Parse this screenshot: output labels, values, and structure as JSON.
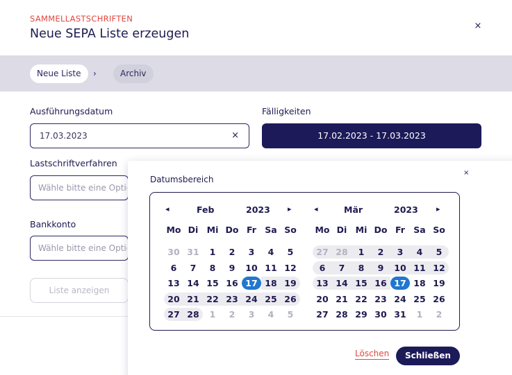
{
  "header": {
    "eyebrow": "SAMMELLASTSCHRIFTEN",
    "title": "Neue SEPA Liste erzeugen",
    "close": "×"
  },
  "breadcrumb": {
    "items": [
      "Neue Liste",
      "Archiv"
    ],
    "separator": "›"
  },
  "form": {
    "execution_date": {
      "label": "Ausführungsdatum",
      "value": "17.03.2023",
      "clear": "×"
    },
    "due_dates": {
      "label": "Fälligkeiten",
      "value": "17.02.2023 - 17.03.2023"
    },
    "method": {
      "label": "Lastschriftverfahren",
      "placeholder": "Wähle bitte eine Option"
    },
    "bank_account": {
      "label": "Bankkonto",
      "placeholder": "Wähle bitte eine Option"
    },
    "show_list_button": "Liste anzeigen"
  },
  "datepicker": {
    "title": "Datumsbereich",
    "close": "×",
    "prev_icon": "◂",
    "next_icon": "▸",
    "weekdays": [
      "Mo",
      "Di",
      "Mi",
      "Do",
      "Fr",
      "Sa",
      "So"
    ],
    "left": {
      "month": "Feb",
      "year": "2023",
      "weeks": [
        [
          "30",
          "31",
          "1",
          "2",
          "3",
          "4",
          "5"
        ],
        [
          "6",
          "7",
          "8",
          "9",
          "10",
          "11",
          "12"
        ],
        [
          "13",
          "14",
          "15",
          "16",
          "17",
          "18",
          "19"
        ],
        [
          "20",
          "21",
          "22",
          "23",
          "24",
          "25",
          "26"
        ],
        [
          "27",
          "28",
          "1",
          "2",
          "3",
          "4",
          "5"
        ]
      ]
    },
    "right": {
      "month": "Mär",
      "year": "2023",
      "weeks": [
        [
          "27",
          "28",
          "1",
          "2",
          "3",
          "4",
          "5"
        ],
        [
          "6",
          "7",
          "8",
          "9",
          "10",
          "11",
          "12"
        ],
        [
          "13",
          "14",
          "15",
          "16",
          "17",
          "18",
          "19"
        ],
        [
          "20",
          "21",
          "22",
          "23",
          "24",
          "25",
          "26"
        ],
        [
          "27",
          "28",
          "29",
          "30",
          "31",
          "1",
          "2"
        ]
      ]
    },
    "delete_label": "Löschen",
    "close_button": "Schließen"
  },
  "colors": {
    "accent": "#1d1a5a",
    "eyebrow": "#e0473f",
    "selected": "#2177cf"
  }
}
